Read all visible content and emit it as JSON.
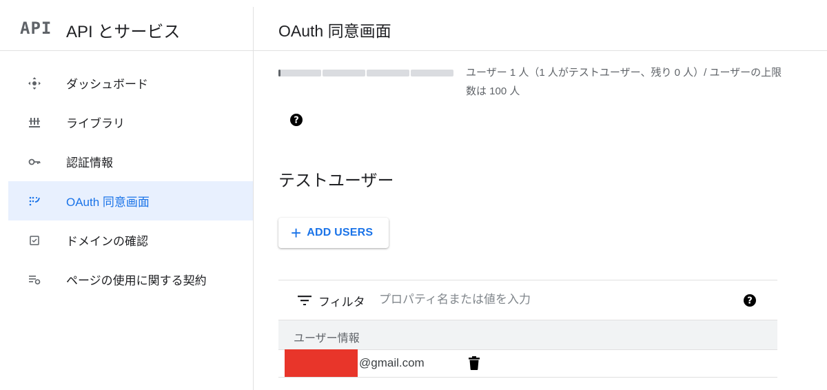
{
  "sidebar": {
    "logo": "API",
    "title": "API とサービス",
    "items": [
      {
        "label": "ダッシュボード",
        "icon": "dashboard-icon"
      },
      {
        "label": "ライブラリ",
        "icon": "library-icon"
      },
      {
        "label": "認証情報",
        "icon": "key-icon"
      },
      {
        "label": "OAuth 同意画面",
        "icon": "consent-screen-icon",
        "active": true
      },
      {
        "label": "ドメインの確認",
        "icon": "checkbox-icon"
      },
      {
        "label": "ページの使用に関する契約",
        "icon": "page-usage-settings-icon"
      }
    ]
  },
  "main": {
    "title": "OAuth 同意画面",
    "quota": {
      "text": "ユーザー 1 人（1 人がテストユーザー、残り 0 人）/ ユーザーの上限数は 100 人",
      "fill_fraction": 0.01
    },
    "section_title": "テストユーザー",
    "add_button_label": "ADD USERS",
    "filter": {
      "label": "フィルタ",
      "placeholder": "プロパティ名または値を入力"
    },
    "table": {
      "column_header": "ユーザー情報",
      "rows": [
        {
          "email": "@gmail.com"
        }
      ]
    }
  },
  "colors": {
    "accent": "#1a73e8",
    "active_bg": "#e8f0fe",
    "redaction": "#e8352a"
  }
}
